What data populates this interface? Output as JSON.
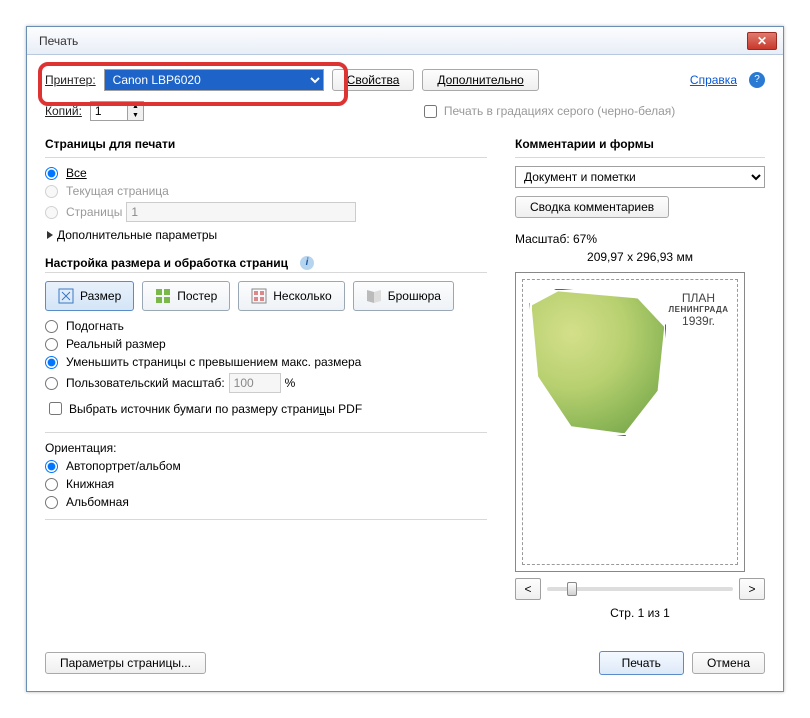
{
  "window": {
    "title": "Печать"
  },
  "header": {
    "printer_label": "Принтер:",
    "printer_value": "Canon LBP6020",
    "properties_btn": "Свойства",
    "advanced_btn": "Дополнительно",
    "help_link": "Справка",
    "copies_label": "Копий:",
    "copies_value": "1",
    "grayscale_label": "Печать в градациях серого (черно-белая)"
  },
  "pages": {
    "group_title": "Страницы для печати",
    "all": "Все",
    "current": "Текущая страница",
    "pages_label": "Страницы",
    "pages_value": "1",
    "more": "Дополнительные параметры"
  },
  "sizing": {
    "group_title": "Настройка размера и обработка страниц",
    "tab_size": "Размер",
    "tab_poster": "Постер",
    "tab_multiple": "Несколько",
    "tab_booklet": "Брошюра",
    "fit": "Подогнать",
    "actual": "Реальный размер",
    "shrink": "Уменьшить страницы с превышением макс. размера",
    "custom": "Пользовательский масштаб:",
    "custom_value": "100",
    "percent": "%",
    "choose_source": "Выбрать источник бумаги по размеру страницы PDF"
  },
  "orientation": {
    "label": "Ориентация:",
    "auto": "Автопортрет/альбом",
    "portrait": "Книжная",
    "landscape": "Альбомная"
  },
  "comments": {
    "group_title": "Комментарии и формы",
    "combo_value": "Документ и пометки",
    "summary_btn": "Сводка комментариев"
  },
  "preview": {
    "scale_label": "Масштаб:  67%",
    "dimensions": "209,97 x 296,93 мм",
    "page_info": "Стр. 1 из 1",
    "prev": "<",
    "next": ">",
    "map_title_small": "ПЛАН",
    "map_title_big": "ЛЕНИНГРАДА",
    "map_title_year": "1939г."
  },
  "footer": {
    "page_setup": "Параметры страницы...",
    "print": "Печать",
    "cancel": "Отмена"
  }
}
